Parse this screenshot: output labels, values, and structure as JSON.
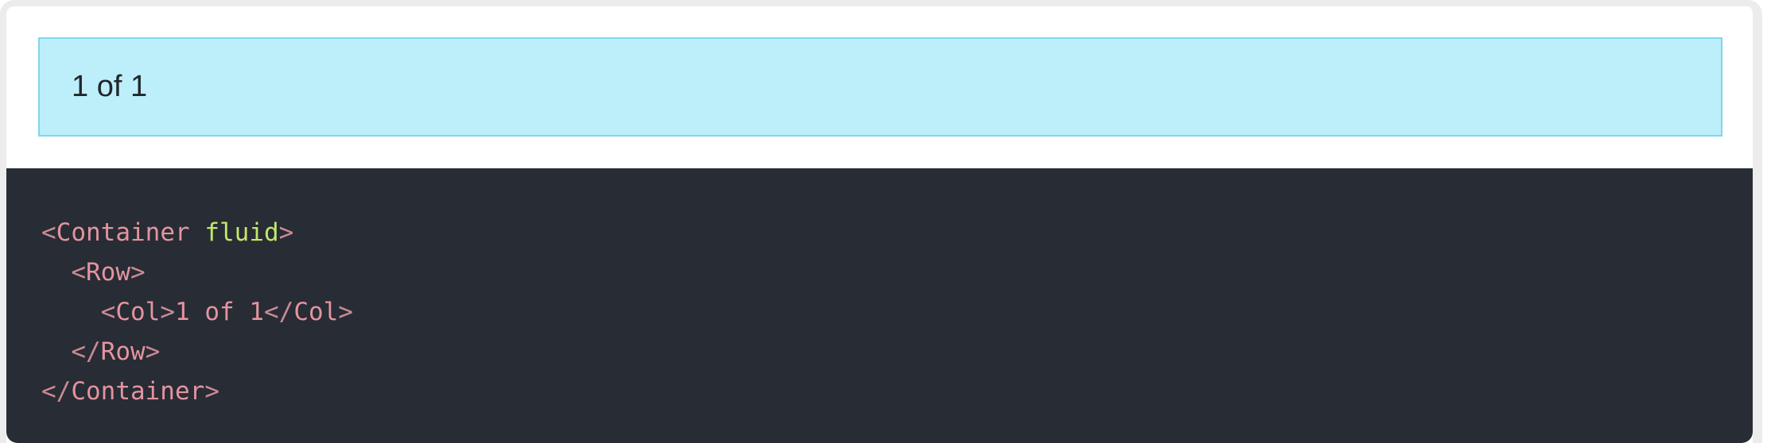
{
  "example": {
    "col_text": "1 of 1"
  },
  "code": {
    "line1": {
      "indent": "",
      "open": "<",
      "tag": "Container",
      "space": " ",
      "attr": "fluid",
      "close": ">"
    },
    "line2": {
      "indent": "  ",
      "open": "<",
      "tag": "Row",
      "close": ">"
    },
    "line3": {
      "indent": "    ",
      "open": "<",
      "tag": "Col",
      "close": ">",
      "text": "1 of 1",
      "end_open": "</",
      "end_tag": "Col",
      "end_close": ">"
    },
    "line4": {
      "indent": "  ",
      "open": "</",
      "tag": "Row",
      "close": ">"
    },
    "line5": {
      "indent": "",
      "open": "</",
      "tag": "Container",
      "close": ">"
    }
  },
  "colors": {
    "col_background": "#bdeffb",
    "col_border": "#7fd6ea",
    "code_background": "#282c34",
    "tag_color": "#e394a0",
    "attr_color": "#bfe86b"
  }
}
